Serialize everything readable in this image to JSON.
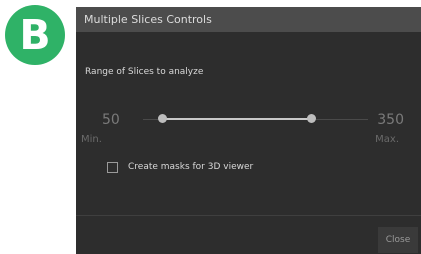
{
  "badge": {
    "letter": "B"
  },
  "dialog": {
    "title": "Multiple Slices Controls",
    "section_label": "Range of Slices to analyze",
    "range": {
      "min_value": "50",
      "max_value": "350",
      "min_label": "Min.",
      "max_label": "Max."
    },
    "checkbox": {
      "label": "Create masks for 3D viewer",
      "checked": false
    },
    "close_label": "Close"
  },
  "colors": {
    "badge": "#2fb267",
    "dialog_bg": "#2d2d2d",
    "title_bar": "#4c4c4c"
  }
}
